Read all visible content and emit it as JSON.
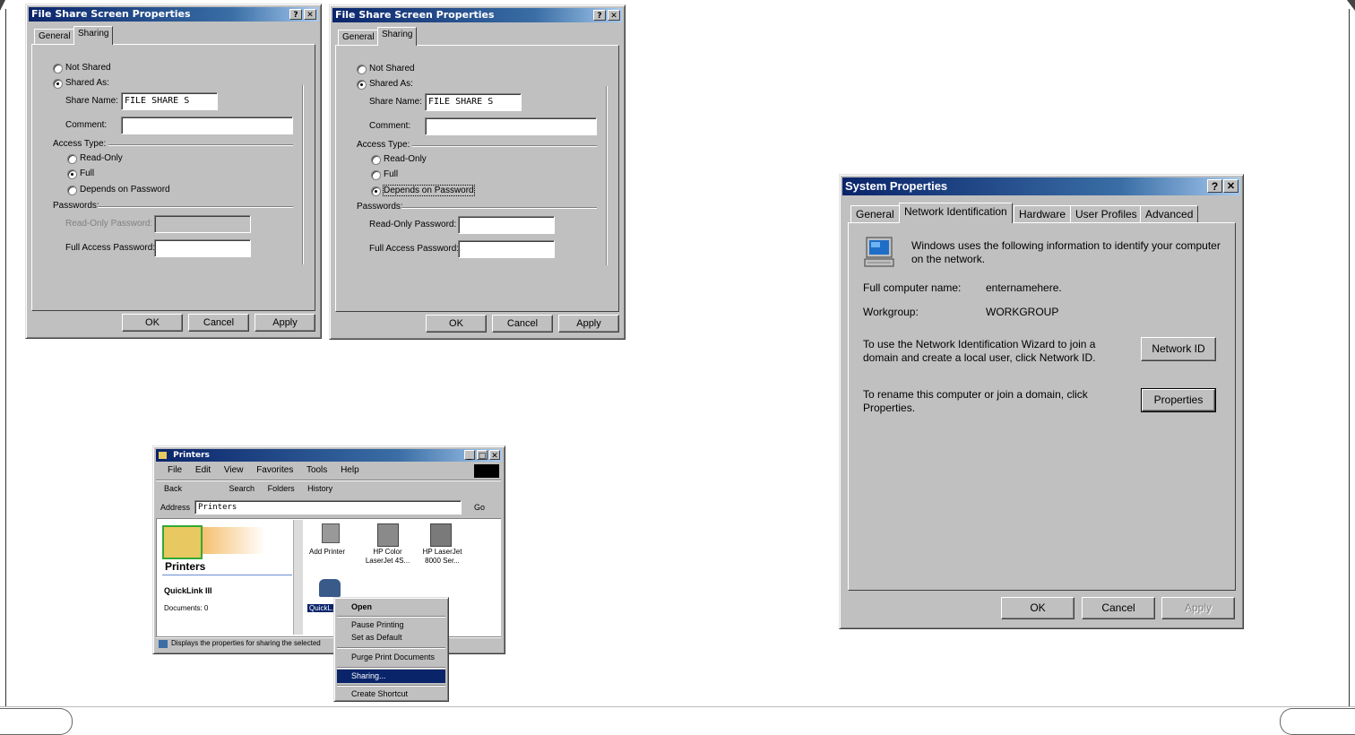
{
  "file_share_left": {
    "title": "File Share Screen Properties",
    "help_btn": "?",
    "close_btn": "✕",
    "tabs": [
      "General",
      "Sharing"
    ],
    "not_shared": "Not Shared",
    "shared_as": "Shared As:",
    "share_name_label": "Share Name:",
    "share_name_value": "FILE SHARE S",
    "comment_label": "Comment:",
    "access_type_label": "Access Type:",
    "read_only": "Read-Only",
    "full": "Full",
    "depends": "Depends on Password",
    "passwords_label": "Passwords:",
    "ro_password": "Read-Only Password:",
    "full_password": "Full Access Password:",
    "ok": "OK",
    "cancel": "Cancel",
    "apply": "Apply"
  },
  "file_share_right": {
    "title": "File Share Screen Properties",
    "help_btn": "?",
    "close_btn": "✕",
    "tabs": [
      "General",
      "Sharing"
    ],
    "not_shared": "Not Shared",
    "shared_as": "Shared As:",
    "share_name_label": "Share Name:",
    "share_name_value": "FILE SHARE S",
    "comment_label": "Comment:",
    "access_type_label": "Access Type:",
    "read_only": "Read-Only",
    "full": "Full",
    "depends": "Depends on Password",
    "passwords_label": "Passwords:",
    "ro_password": "Read-Only Password:",
    "full_password": "Full Access Password:",
    "ok": "OK",
    "cancel": "Cancel",
    "apply": "Apply"
  },
  "printers": {
    "title": "Printers",
    "menu": [
      "File",
      "Edit",
      "View",
      "Favorites",
      "Tools",
      "Help"
    ],
    "toolbar": [
      "Back",
      "Search",
      "Folders",
      "History"
    ],
    "address_label": "Address",
    "address_value": "Printers",
    "go_label": "Go",
    "panel_title": "Printers",
    "panel_item": "QuickLink III",
    "panel_sub": "Documents: 0",
    "icons": [
      "Add Printer",
      "HP Color LaserJet 4S...",
      "HP LaserJet 8000 Ser..."
    ],
    "selected_icon": "QuickL...",
    "status": "Displays the properties for sharing the selected",
    "context_menu": [
      "Open",
      "Pause Printing",
      "Set as Default",
      "Purge Print Documents",
      "Sharing...",
      "Create Shortcut"
    ]
  },
  "system_properties": {
    "title": "System Properties",
    "help_btn": "?",
    "close_btn": "✕",
    "tabs": [
      "General",
      "Network Identification",
      "Hardware",
      "User Profiles",
      "Advanced"
    ],
    "intro": "Windows uses the following information to identify your computer on the network.",
    "full_name_label": "Full computer name:",
    "full_name_value": "enternamehere.",
    "workgroup_label": "Workgroup:",
    "workgroup_value": "WORKGROUP",
    "wizard_text": "To use the Network Identification Wizard to join a domain and create a local user, click Network ID.",
    "network_id_btn": "Network ID",
    "rename_text": "To rename this computer or join a domain, click Properties.",
    "properties_btn": "Properties",
    "ok": "OK",
    "cancel": "Cancel",
    "apply": "Apply"
  }
}
